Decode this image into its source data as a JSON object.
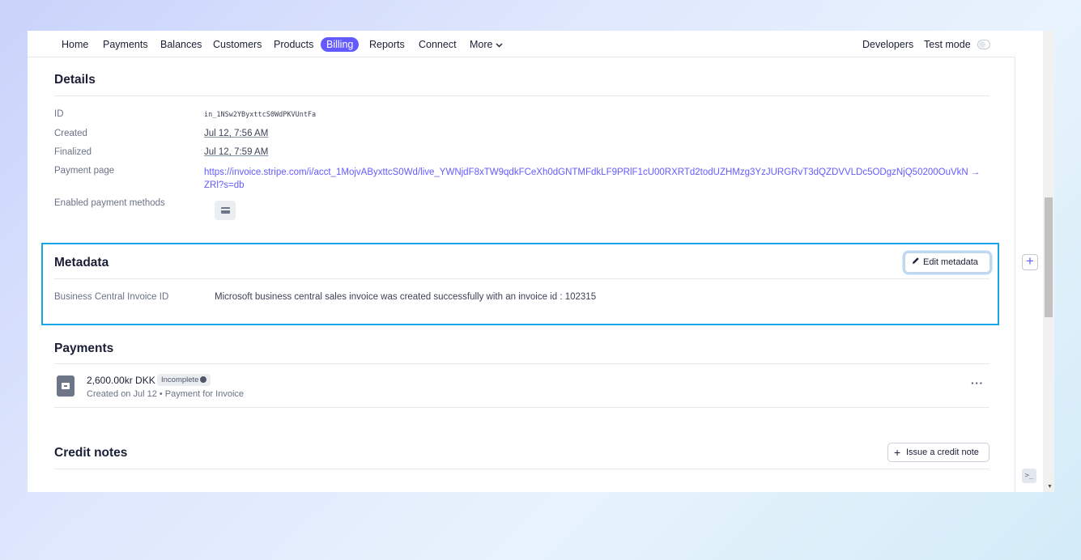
{
  "nav": {
    "items": [
      "Home",
      "Payments",
      "Balances",
      "Customers",
      "Products",
      "Billing",
      "Reports",
      "Connect",
      "More"
    ],
    "active": "Billing",
    "more_chevron": "chevron-down-icon",
    "developers": "Developers",
    "test_mode": "Test mode",
    "test_mode_on": false
  },
  "details": {
    "title": "Details",
    "rows": [
      {
        "label": "ID",
        "value": "in_1NSw2YByxttcS0WdPKVUntFa"
      },
      {
        "label": "Created",
        "value": "Jul 12, 7:56 AM"
      },
      {
        "label": "Finalized",
        "value": "Jul 12, 7:59 AM"
      },
      {
        "label": "Payment page",
        "value": "https://invoice.stripe.com/i/acct_1MojvAByxttcS0Wd/live_YWNjdF8xTW9qdkFCeXh0dGNTMFdkLF9PRlF1cU00RXRTd2todUZHMzg3YzJURGRvT3dQZDVVLDc5ODgzNjQ50200OuVkN →",
        "value_cont": "ZRl?s=db"
      },
      {
        "label": "Enabled payment methods",
        "value_icon": "card-icon"
      }
    ]
  },
  "metadata": {
    "title": "Metadata",
    "edit_label": "Edit metadata",
    "edit_icon": "pencil-icon",
    "key": "Business Central Invoice ID",
    "value": "Microsoft business central sales invoice was created successfully with an invoice id : 102315",
    "highlight_color": "#1aa3e8"
  },
  "payments": {
    "title": "Payments",
    "amount": "2,600.00kr DKK",
    "status": "Incomplete",
    "subtitle": "Created on Jul 12 • Payment for Invoice",
    "more": "···"
  },
  "credit_notes": {
    "title": "Credit notes",
    "issue_label": "Issue a credit note"
  },
  "colors": {
    "accent": "#635bff",
    "text": "#1a1f36",
    "muted": "#697386"
  }
}
